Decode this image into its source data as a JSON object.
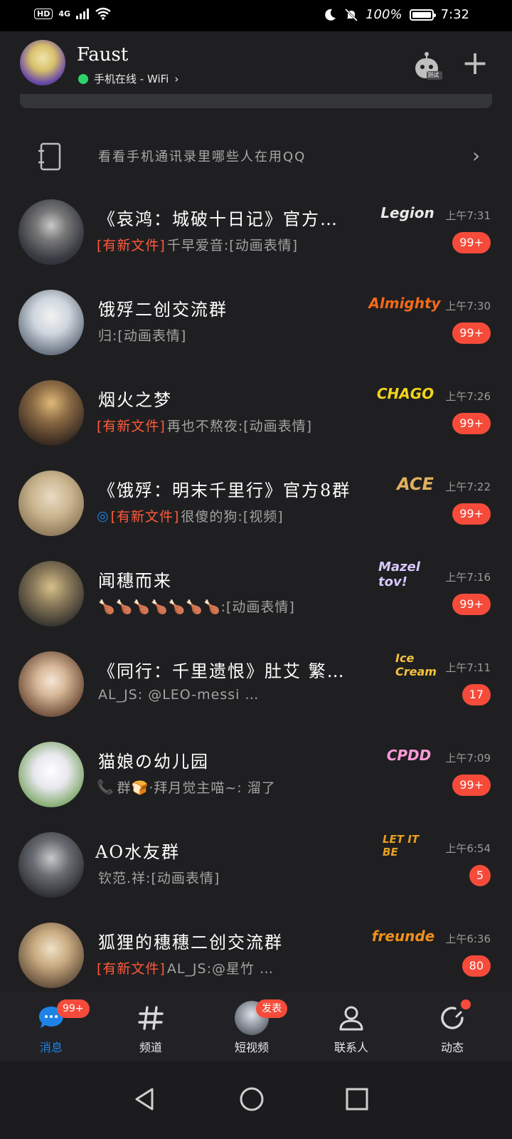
{
  "status_bar": {
    "hd": "HD",
    "network": "4G",
    "battery_pct": "100%",
    "time": "7:32"
  },
  "header": {
    "user_name": "Faust",
    "online_status": "手机在线 - WiFi",
    "bot_badge": "测试"
  },
  "contacts_banner": {
    "text": "看看手机通讯录里哪些人在用QQ"
  },
  "conversations": [
    {
      "title": "《哀鸿：城破十日记》官方…",
      "brand": "Legion",
      "time": "上午7:31",
      "tag": "[有新文件]",
      "preview": "千早爱音:[动画表情]",
      "badge": "99+",
      "brand_color": "#e8e8e8"
    },
    {
      "title": "饿殍二创交流群",
      "brand": "Almighty",
      "time": "上午7:30",
      "tag": "",
      "preview": "归:[动画表情]",
      "badge": "99+",
      "brand_color": "#f26a1b"
    },
    {
      "title": "烟火之梦",
      "brand": "CHAGO",
      "time": "上午7:26",
      "tag": "[有新文件]",
      "preview": "再也不熬夜:[动画表情]",
      "badge": "99+",
      "brand_color": "#f2d41b"
    },
    {
      "title": "《饿殍：明末千里行》官方8群",
      "brand": "ACE",
      "time": "上午7:22",
      "tag": "[有新文件]",
      "preview": "很傻的狗:[视频]",
      "badge": "99+",
      "brand_color": "#e0b060"
    },
    {
      "title": "闻穗而来",
      "brand": "Mazel tov!",
      "time": "上午7:16",
      "tag": "",
      "preview": "🍗🍗🍗🍗🍗🍗🍗:[动画表情]",
      "badge": "99+",
      "brand_color": "#d8c8ff"
    },
    {
      "title": "《同行：千里遗恨》肚艾 繁…",
      "brand": "Ice Cream",
      "time": "上午7:11",
      "tag": "",
      "preview": "AL_JS: @LEO-messi …",
      "badge": "17",
      "brand_color": "#f7c23a"
    },
    {
      "title": "猫娘の幼儿园",
      "brand": "CPDD",
      "time": "上午7:09",
      "tag": "",
      "preview": "群🍞·拜月觉主喵~: 溜了",
      "badge": "99+",
      "brand_color": "#ff9ad8"
    },
    {
      "title": "AO水友群",
      "brand": "LET IT BE",
      "time": "上午6:54",
      "tag": "",
      "preview": "钦范.祥:[动画表情]",
      "badge": "5",
      "brand_color": "#e8a020"
    },
    {
      "title": "狐狸的穗穗二创交流群",
      "brand": "freunde",
      "time": "上午6:36",
      "tag": "[有新文件]",
      "preview": "AL_JS:@星竹 …",
      "badge": "80",
      "brand_color": "#f0901b"
    }
  ],
  "tabs": [
    {
      "label": "消息",
      "badge": "99+"
    },
    {
      "label": "频道"
    },
    {
      "label": "短视频",
      "badge": "发表"
    },
    {
      "label": "联系人"
    },
    {
      "label": "动态"
    }
  ],
  "colors": {
    "background": "#1f1f21",
    "accent_blue": "#1e83e6",
    "badge_red": "#f64b3a",
    "tag_red": "#ff5a3c",
    "online_green": "#2fd36a"
  }
}
